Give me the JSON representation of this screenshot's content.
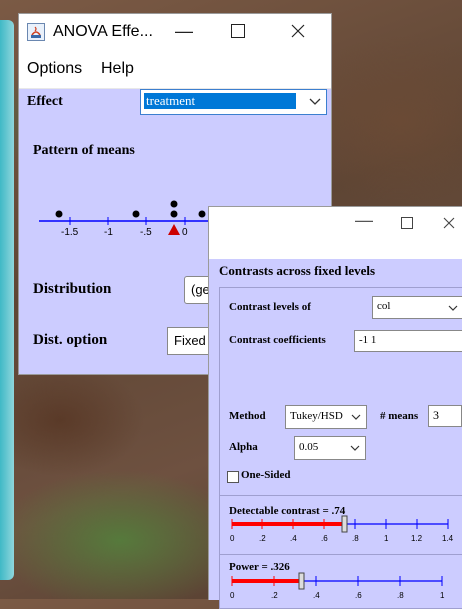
{
  "background": {
    "teal_edge": "#3fb9c6"
  },
  "anova_window": {
    "title": "ANOVA Effe...",
    "menu": [
      "Options",
      "Help"
    ],
    "effect_label": "Effect",
    "effect_value": "treatment",
    "pattern_label": "Pattern of means",
    "axis_ticks": [
      "-1.5",
      "-1",
      "-.5",
      "0"
    ],
    "distribution_label": "Distribution",
    "distribution_value": "(ge",
    "dist_option_label": "Dist. option",
    "dist_option_value": "Fixed",
    "colors": {
      "background": "#ccccff",
      "axis": "#0000ff",
      "marker": "#cc0000",
      "selection": "#0078d7"
    }
  },
  "contrasts_window": {
    "header": "Contrasts across fixed levels",
    "contrast_levels_label": "Contrast levels of",
    "contrast_levels_value": "col",
    "coefficients_label": "Contrast coefficients",
    "coefficients_value": "-1 1",
    "method_label": "Method",
    "method_value": "Tukey/HSD",
    "means_label": "# means",
    "means_value": "3",
    "alpha_label": "Alpha",
    "alpha_value": "0.05",
    "one_sided_label": "One-Sided",
    "one_sided_checked": false,
    "detectable_label": "Detectable contrast = .74",
    "detectable_ticks": [
      "0",
      ".2",
      ".4",
      ".6",
      ".8",
      "1",
      "1.2",
      "1.4"
    ],
    "detectable_value": 0.74,
    "power_label": "Power = .326",
    "power_ticks": [
      "0",
      ".2",
      ".4",
      ".6",
      ".8",
      "1"
    ],
    "power_value": 0.326,
    "colors": {
      "slider_fill": "#ff0000",
      "slider_line": "#0000ff"
    }
  }
}
